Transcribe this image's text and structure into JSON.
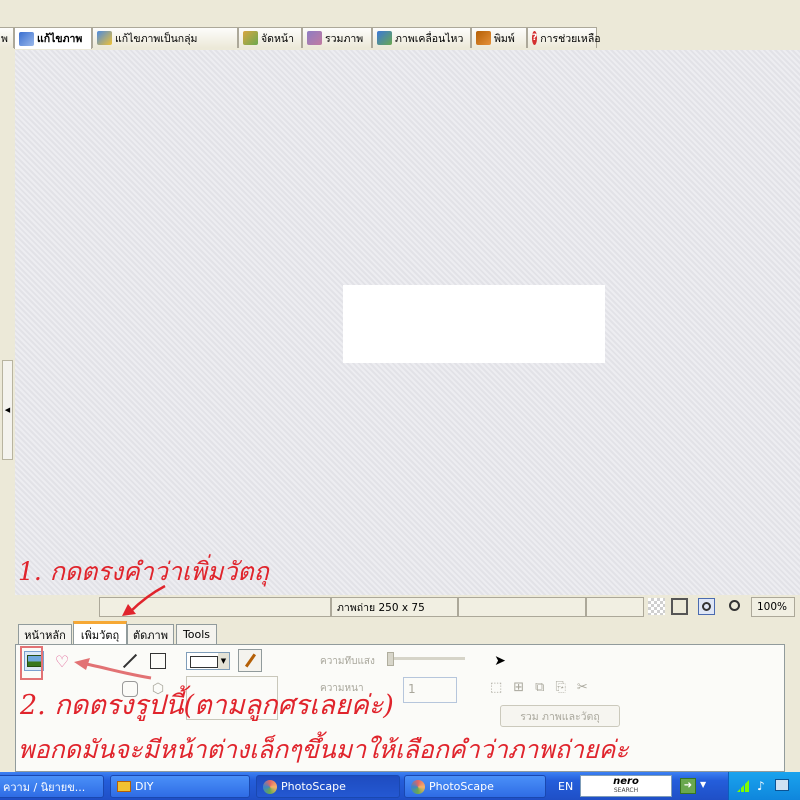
{
  "top_tabs": [
    {
      "label": "พ",
      "icon": "clipped-icon",
      "active": false
    },
    {
      "label": "แก้ไขภาพ",
      "icon": "photo-edit-icon",
      "active": true
    },
    {
      "label": "แก้ไขภาพเป็นกลุ่ม",
      "icon": "batch-edit-icon",
      "active": false
    },
    {
      "label": "จัดหน้า",
      "icon": "page-layout-icon",
      "active": false
    },
    {
      "label": "รวมภาพ",
      "icon": "combine-icon",
      "active": false
    },
    {
      "label": "ภาพเคลื่อนไหว",
      "icon": "animated-gif-icon",
      "active": false
    },
    {
      "label": "พิมพ์",
      "icon": "printer-icon",
      "active": false
    },
    {
      "label": "การช่วยเหลือ",
      "icon": "help-icon",
      "active": false
    }
  ],
  "status": {
    "image_info": "ภาพถ่าย 250 x 75",
    "zoom": "100%"
  },
  "panel_tabs": [
    {
      "label": "หน้าหลัก",
      "active": false
    },
    {
      "label": "เพิ่มวัตถุ",
      "active": true
    },
    {
      "label": "ตัดภาพ",
      "active": false
    },
    {
      "label": "Tools",
      "active": false
    }
  ],
  "tools": {
    "opacity_label": "ความทึบแสง",
    "thickness_label": "ความหนา",
    "thickness_value": "1",
    "merge_button": "รวม ภาพและวัตถุ"
  },
  "annotations": {
    "step1": "1. กดตรงคำว่าเพิ่มวัตถุ",
    "step2": "2. กดตรงรูปนี้(ตามลูกศรเลยค่ะ)",
    "step3": "พอกดมันจะมีหน้าต่างเล็กๆขึ้นมาให้เลือกคำว่าภาพถ่ายค่ะ",
    "color": "#e0242c"
  },
  "taskbar": {
    "items": [
      "ความ / นิยายข...",
      "DIY",
      "PhotoScape",
      "PhotoScape"
    ],
    "language": "EN",
    "search_brand": "nero",
    "search_sub": "SEARCH"
  }
}
